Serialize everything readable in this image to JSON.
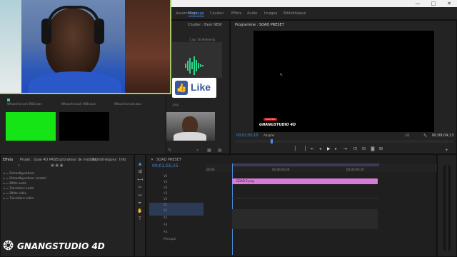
{
  "window": {
    "minimize": "—",
    "maximize": "□",
    "close": "✕"
  },
  "workspaces": [
    "Assemblage",
    "Montage",
    "Couleur",
    "Effets",
    "Audio",
    "Images",
    "Bibliothèque"
  ],
  "active_workspace": "Montage",
  "project": {
    "tab": "Chutier : Best NEW",
    "selection_info": "1 sur 16 éléments sélectionnés",
    "items": [
      {
        "name": "Whoosh brush SWO.wav"
      },
      {
        "name": "Whoosh brush HOB.wav"
      },
      {
        "name": "Whoosh brush.wav"
      },
      {
        "name": ".png"
      },
      {
        "name": "Whoosh brush.wav"
      }
    ],
    "like_text": "Like"
  },
  "program_monitor": {
    "tab": "Programme : SOAD PRESET",
    "timecode_left": "00;01;55;15",
    "fit": "Adapter",
    "scale": "1/2",
    "timecode_right": "00;09;04;13",
    "overlay_badge": "CASCHEN",
    "overlay_logo": "GNANGSTUDIO 4D"
  },
  "effects_panel": {
    "tabs": [
      "Effets",
      "Projet : Goal 4D PAS",
      "Explorateur de médias",
      "Bibliothèques",
      "Info"
    ],
    "items": [
      "Préconfigurations",
      "Préconfigurations Lumetri",
      "Effets audio",
      "Transitions audio",
      "Effets vidéo",
      "Transitions vidéo"
    ]
  },
  "timeline": {
    "tab": "SOAD PRESET",
    "timecode": "00;01;55;15",
    "ruler": [
      "00;00",
      "00;00;04;29",
      "00;00;09;29"
    ],
    "clip_name": "GOAD 2.png",
    "tracks": [
      "V6",
      "V5",
      "V4",
      "V3",
      "V2",
      "V1",
      "A1",
      "A2",
      "A3",
      "A4"
    ],
    "footer": "Principal"
  },
  "watermark": "GNANGSTUDIO 4D"
}
